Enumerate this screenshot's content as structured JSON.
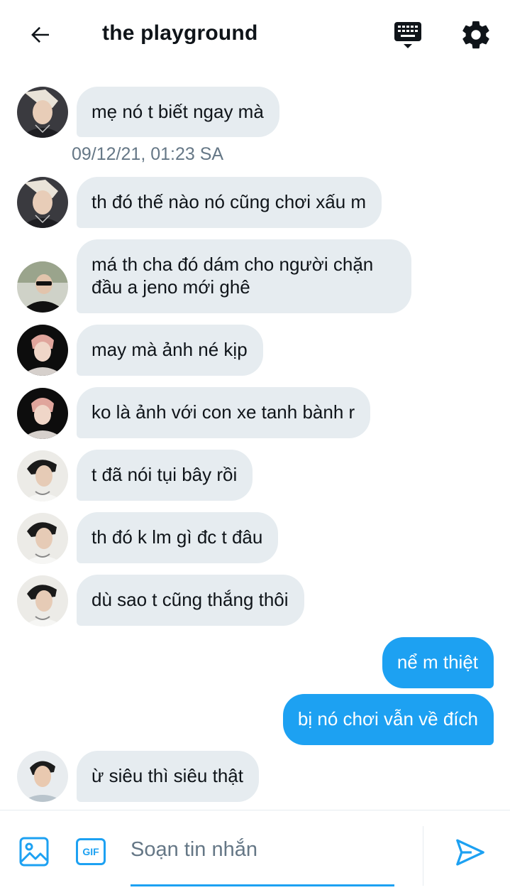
{
  "header": {
    "title": "the playground"
  },
  "icons": {
    "back": "arrow-left-icon",
    "keyboard": "keyboard-icon",
    "settings": "gear-icon",
    "media": "image-icon",
    "gif": "gif-icon",
    "send": "send-icon"
  },
  "colors": {
    "accent": "#1da1f2",
    "bubble_in": "#e6ecf0",
    "text": "#0f1419",
    "muted": "#657786"
  },
  "messages": [
    {
      "direction": "in",
      "text": "mẹ nó t biết ngay mà"
    },
    {
      "direction": "in",
      "text": "th đó thế nào nó cũng chơi xấu m"
    },
    {
      "direction": "in",
      "text": "má th cha đó dám cho người chặn đầu a jeno mới ghê"
    },
    {
      "direction": "in",
      "text": "may mà ảnh né kịp"
    },
    {
      "direction": "in",
      "text": "ko là ảnh với con xe tanh bành r"
    },
    {
      "direction": "in",
      "text": "t đã nói tụi bây rồi"
    },
    {
      "direction": "in",
      "text": "th đó k lm gì đc t đâu"
    },
    {
      "direction": "in",
      "text": "dù sao t cũng thắng thôi"
    },
    {
      "direction": "out",
      "text": "nể m thiệt"
    },
    {
      "direction": "out",
      "text": "bị nó chơi vẫn về đích"
    },
    {
      "direction": "in",
      "text": "ừ siêu thì siêu thật"
    }
  ],
  "timestamp": "09/12/21, 01:23 SA",
  "composer": {
    "placeholder": "Soạn tin nhắn",
    "gif_label": "GIF"
  }
}
